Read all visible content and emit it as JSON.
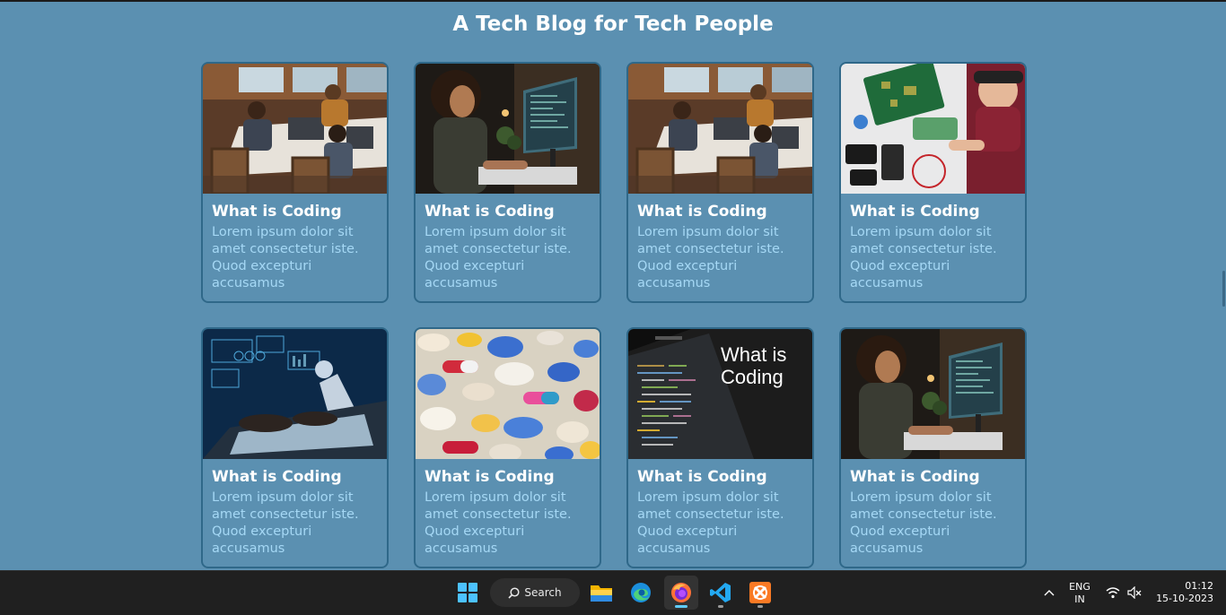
{
  "page": {
    "title": "A Tech Blog for Tech People"
  },
  "cards": [
    {
      "title": "What is Coding",
      "text": "Lorem ipsum dolor sit amet consectetur iste. Quod excepturi accusamus",
      "image": "team-coworking-photo"
    },
    {
      "title": "What is Coding",
      "text": "Lorem ipsum dolor sit amet consectetur iste. Quod excepturi accusamus",
      "image": "woman-at-computer-photo"
    },
    {
      "title": "What is Coding",
      "text": "Lorem ipsum dolor sit amet consectetur iste. Quod excepturi accusamus",
      "image": "team-coworking-photo"
    },
    {
      "title": "What is Coding",
      "text": "Lorem ipsum dolor sit amet consectetur iste. Quod excepturi accusamus",
      "image": "electronics-repair-photo"
    },
    {
      "title": "What is Coding",
      "text": "Lorem ipsum dolor sit amet consectetur iste. Quod excepturi accusamus",
      "image": "ai-laptop-photo"
    },
    {
      "title": "What is Coding",
      "text": "Lorem ipsum dolor sit amet consectetur iste. Quod excepturi accusamus",
      "image": "colorful-pills-photo"
    },
    {
      "title": "What is Coding",
      "text": "Lorem ipsum dolor sit amet consectetur iste. Quod excepturi accusamus",
      "image": "code-editor-photo",
      "overlay_text": "What is Coding"
    },
    {
      "title": "What is Coding",
      "text": "Lorem ipsum dolor sit amet consectetur iste. Quod excepturi accusamus",
      "image": "woman-at-computer-photo"
    }
  ],
  "taskbar": {
    "search_label": "Search",
    "apps": [
      "start-icon",
      "file-explorer-icon",
      "edge-icon",
      "firefox-icon",
      "vscode-icon",
      "xampp-icon"
    ],
    "language_line1": "ENG",
    "language_line2": "IN",
    "time": "01:12",
    "date": "15-10-2023"
  },
  "colors": {
    "background": "#5b90b1",
    "card_border": "#2f6889",
    "body_text": "#a5d8f5",
    "taskbar": "#202020"
  }
}
